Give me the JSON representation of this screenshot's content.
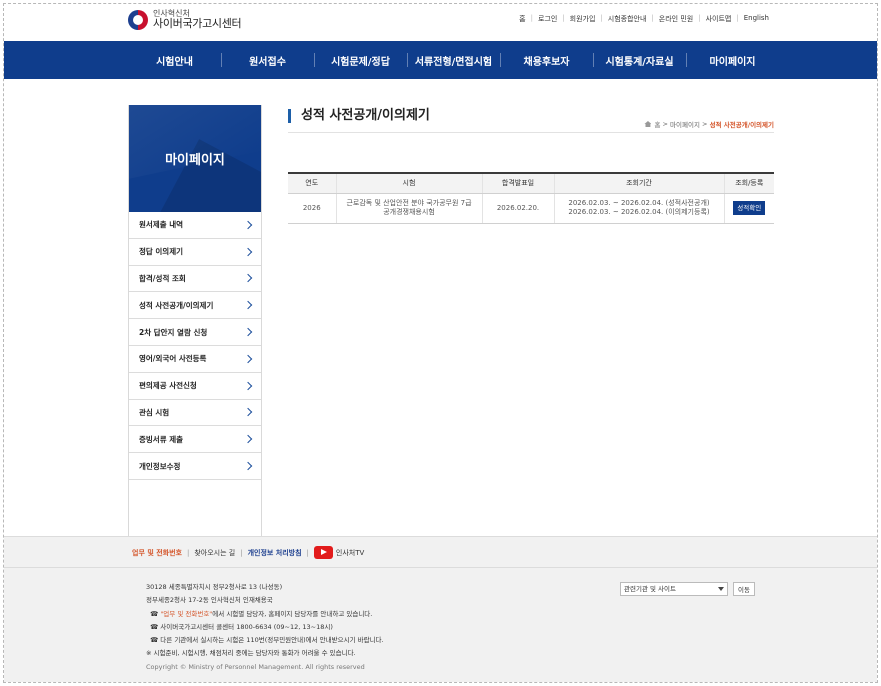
{
  "header": {
    "logo_sub": "인사혁신처",
    "logo_main": "사이버국가고시센터",
    "util_links": [
      "홈",
      "로그인",
      "회원가입",
      "시험종합안내",
      "온라인 민원",
      "사이트맵",
      "English"
    ]
  },
  "gnb": [
    "시험안내",
    "원서접수",
    "시험문제/정답",
    "서류전형/면접시험",
    "채용후보자",
    "시험통계/자료실",
    "마이페이지"
  ],
  "sidebar": {
    "title": "마이페이지",
    "items": [
      "원서제출 내역",
      "정답 이의제기",
      "합격/성적 조회",
      "성적 사전공개/이의제기",
      "2차 답안지 열람 신청",
      "영어/외국어 사전등록",
      "편의제공 사전신청",
      "관심 시험",
      "증빙서류 제출",
      "개인정보수정"
    ]
  },
  "page": {
    "title": "성적 사전공개/이의제기",
    "breadcrumb": {
      "home": "홈",
      "sep": ">",
      "level1": "마이페이지",
      "current": "성적 사전공개/이의제기"
    }
  },
  "table": {
    "headers": [
      "연도",
      "시험",
      "합격발표일",
      "조회기간",
      "조회/등록"
    ],
    "rows": [
      {
        "year": "2026",
        "exam_line1": "근로감독 및 산업안전 분야 국가공무원 7급",
        "exam_line2": "공개경쟁채용시험",
        "announce_date": "2026.02.20.",
        "period_line1": "2026.02.03. ~ 2026.02.04. (성적사전공개)",
        "period_line2": "2026.02.03. ~ 2026.02.04. (이의제기등록)",
        "button": "성적확인"
      }
    ]
  },
  "footer": {
    "links": {
      "duty_phone": "업무 및 전화번호",
      "directions": "찾아오시는 길",
      "privacy": "개인정보 처리방침",
      "tv": "인사처TV"
    },
    "address1": "30128 세종특별자치시 정부2청사로 13 (나성동)",
    "address2": "정부세종2청사 17-2동 인사혁신처 인재채용국",
    "info1_prefix": "☎ ",
    "info1_highlight": "\"업무 및 전화번호\"",
    "info1_suffix": "에서 시험별 담당자, 홈페이지 담당자를 안내하고 있습니다.",
    "info2": "☎ 사이버국가고시센터 콜센터 1800-6634 (09~12, 13~18시)",
    "info3": "☎ 다른 기관에서 실시하는 시험은 110번(정부민원안내)에서 안내받으시기 바랍니다.",
    "info4": "※ 시험준비, 시험시행, 채점처리 중에는 담당자와 통화가 어려울 수 있습니다.",
    "copyright": "Copyright © Ministry of Personnel Management. All rights reserved",
    "related_select": "관련기관 및 사이트",
    "go_button": "이동"
  },
  "colors": {
    "navy": "#0f3d8c",
    "accent_orange": "#d4552a",
    "title_bar_blue": "#1d5fa8",
    "youtube_red": "#e21b1b"
  }
}
